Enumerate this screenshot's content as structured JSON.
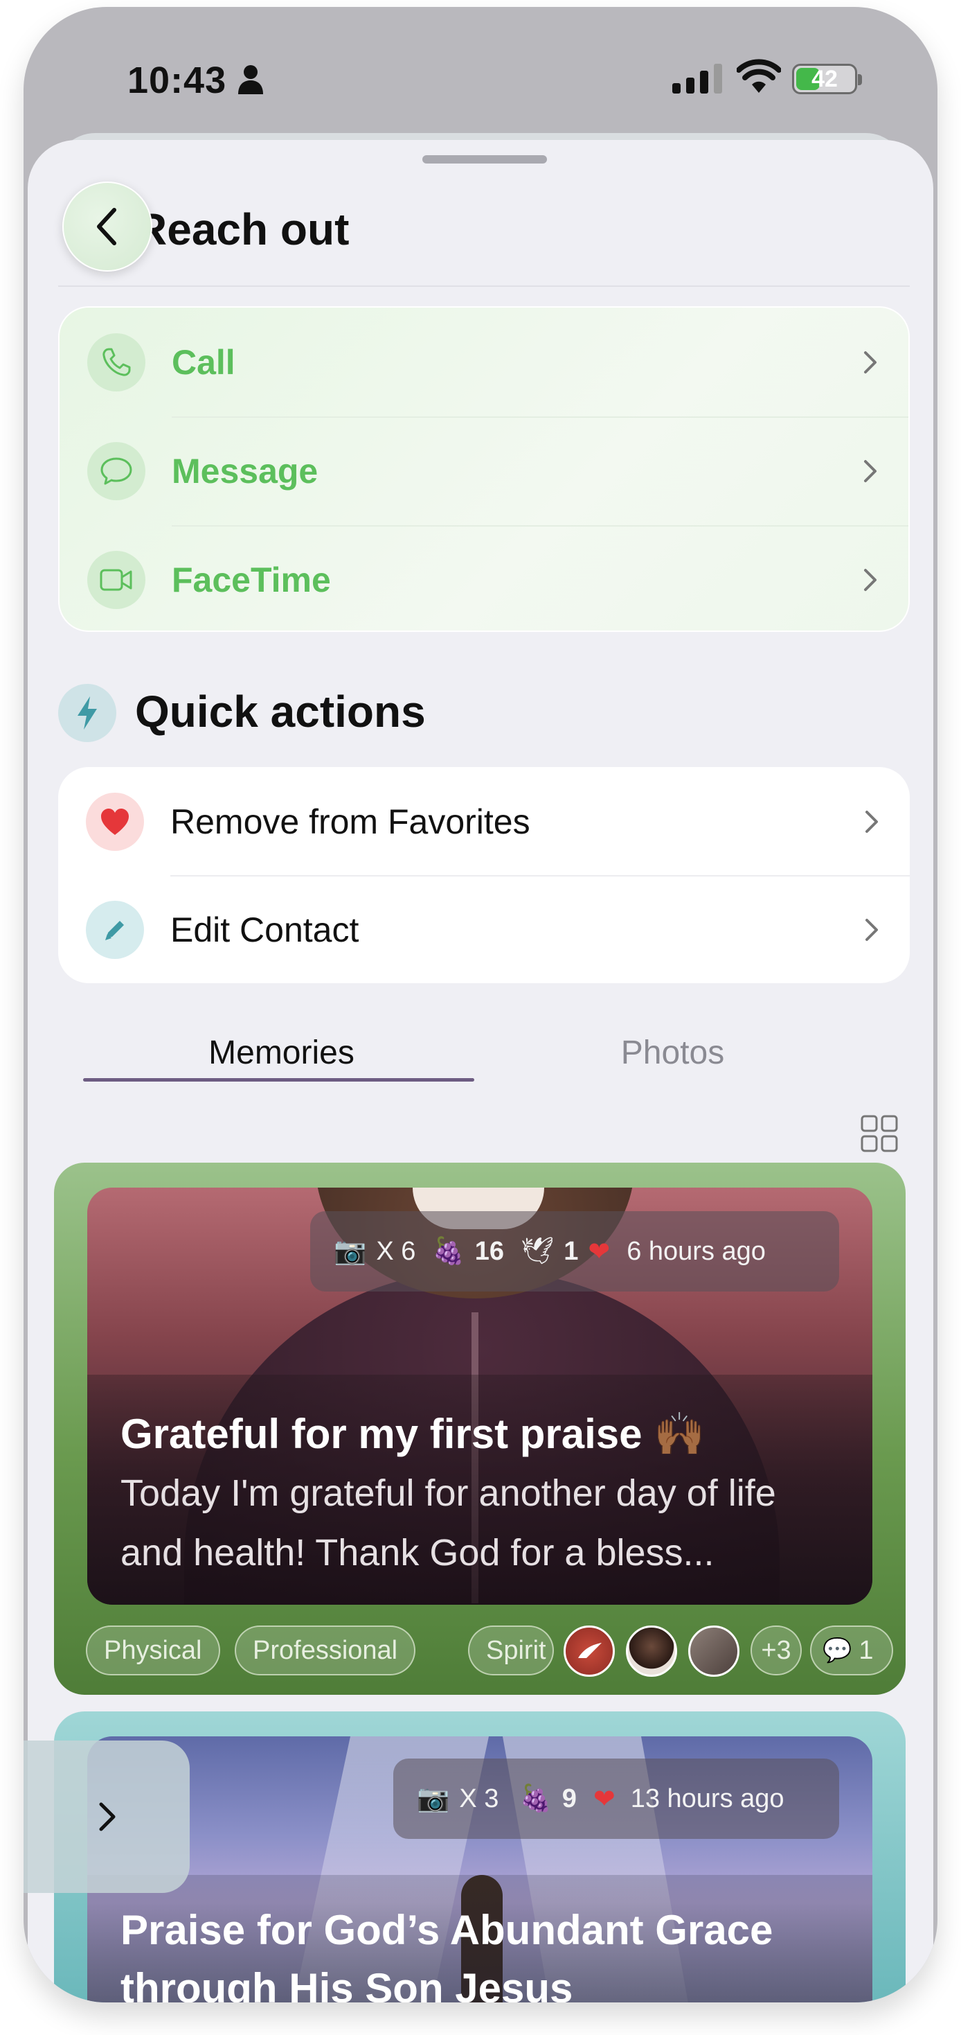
{
  "status_bar": {
    "time": "10:43",
    "battery_pct": "42",
    "battery_level": 0.42
  },
  "header": {
    "title": "Reach out",
    "back_icon": "chevron-left-icon"
  },
  "reach_out": {
    "items": [
      {
        "label": "Call",
        "icon": "phone-icon"
      },
      {
        "label": "Message",
        "icon": "chat-bubble-icon"
      },
      {
        "label": "FaceTime",
        "icon": "video-camera-icon"
      }
    ],
    "accent_color": "#5cbf5c"
  },
  "quick_actions": {
    "title": "Quick actions",
    "icon": "lightning-icon",
    "items": [
      {
        "label": "Remove from Favorites",
        "icon": "heart-icon",
        "icon_color": "#e5373a"
      },
      {
        "label": "Edit Contact",
        "icon": "pencil-icon",
        "icon_color": "#3f9aa5"
      }
    ]
  },
  "tabs": {
    "memories": "Memories",
    "photos": "Photos",
    "active": "Memories"
  },
  "memories": [
    {
      "photos_count": "X 6",
      "grapes_count": "16",
      "dove_count": "1",
      "time_ago": "6 hours ago",
      "title": "Grateful for my first praise 🙌🏾",
      "body": "Today I'm grateful for another day of life and health! Thank God for a bless...",
      "tags": [
        "Physical",
        "Professional",
        "Spirit"
      ],
      "more_people": "+3",
      "comments": "1"
    },
    {
      "photos_count": "X 3",
      "grapes_count": "9",
      "time_ago": "13 hours ago",
      "title": "Praise for God’s Abundant Grace through His Son Jesus"
    }
  ]
}
